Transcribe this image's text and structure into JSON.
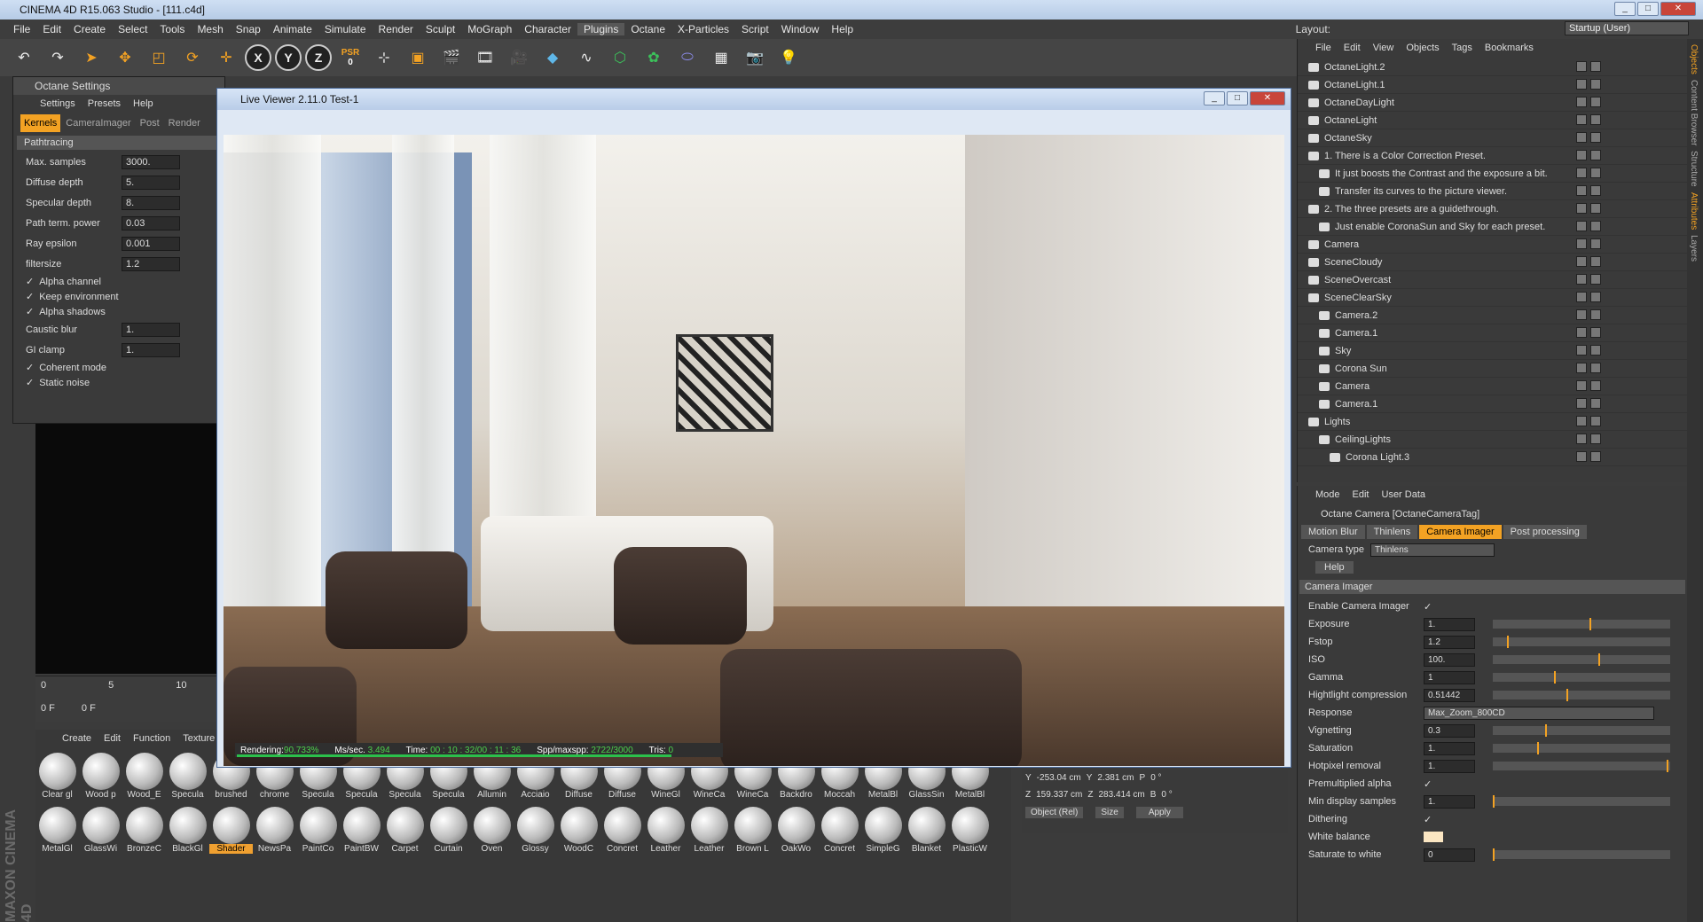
{
  "app": {
    "title": "CINEMA 4D R15.063 Studio - [111.c4d]",
    "layout_label": "Layout:",
    "layout_value": "Startup (User)"
  },
  "menu": [
    "File",
    "Edit",
    "Create",
    "Select",
    "Tools",
    "Mesh",
    "Snap",
    "Animate",
    "Simulate",
    "Render",
    "Sculpt",
    "MoGraph",
    "Character",
    "Plugins",
    "Octane",
    "X-Particles",
    "Script",
    "Window",
    "Help"
  ],
  "toolbar": {
    "x": "X",
    "y": "Y",
    "z": "Z",
    "psr": "PSR",
    "psr_num": "0"
  },
  "octane_settings": {
    "title": "Octane Settings",
    "menu": [
      "Settings",
      "Presets",
      "Help"
    ],
    "tabs": [
      "Kernels",
      "CameraImager",
      "Post",
      "Render"
    ],
    "section": "Pathtracing",
    "rows": [
      [
        "Max. samples",
        "3000."
      ],
      [
        "Diffuse depth",
        "5."
      ],
      [
        "Specular depth",
        "8."
      ],
      [
        "Path term. power",
        "0.03"
      ],
      [
        "Ray epsilon",
        "0.001"
      ],
      [
        "filtersize",
        "1.2"
      ]
    ],
    "checks": [
      "Alpha channel",
      "Keep environment",
      "Alpha shadows"
    ],
    "rows2": [
      [
        "Caustic blur",
        "1."
      ],
      [
        "GI clamp",
        "1."
      ]
    ],
    "checks2": [
      "Coherent mode",
      "Static noise"
    ]
  },
  "live_viewer": {
    "title": "Live Viewer 2.11.0 Test-1",
    "status": {
      "rendering_label": "Rendering:",
      "rendering": "90.733%",
      "ms_label": "Ms/sec.",
      "ms": "3.494",
      "time_label": "Time:",
      "time": "00 : 10 : 32/00 : 11 : 36",
      "spp_label": "Spp/maxspp:",
      "spp": "2722/3000",
      "tris_label": "Tris:",
      "tris": "0"
    },
    "progress": 0.907
  },
  "object_manager": {
    "menu": [
      "File",
      "Edit",
      "View",
      "Objects",
      "Tags",
      "Bookmarks"
    ],
    "items": [
      "OctaneLight.2",
      "OctaneLight.1",
      "OctaneDayLight",
      "OctaneLight",
      "OctaneSky",
      "1.  There is a Color Correction Preset.",
      "It just boosts the Contrast and the exposure a bit.",
      "Transfer its curves to the picture viewer.",
      "2.  The three presets are a guidethrough.",
      "Just enable CoronaSun and Sky for each preset.",
      "Camera",
      "SceneCloudy",
      "SceneOvercast",
      "SceneClearSky",
      "Camera.2",
      "Camera.1",
      "Sky",
      "Corona Sun",
      "Camera",
      "Camera.1",
      "Lights",
      "CeilingLights",
      "Corona Light.3"
    ]
  },
  "attr_manager": {
    "menu": [
      "Mode",
      "Edit",
      "User Data"
    ],
    "title": "Octane Camera [OctaneCameraTag]",
    "tabs": [
      "Motion Blur",
      "Thinlens",
      "Camera Imager",
      "Post processing"
    ],
    "camera_type_label": "Camera type",
    "camera_type": "Thinlens",
    "help": "Help",
    "section": "Camera Imager",
    "enable_label": "Enable Camera Imager",
    "rows": [
      [
        "Exposure",
        "1.",
        0.55
      ],
      [
        "Fstop",
        "1.2",
        0.08
      ],
      [
        "ISO",
        "100.",
        0.6
      ],
      [
        "Gamma",
        "1",
        0.35
      ],
      [
        "Hightlight compression",
        "0.51442",
        0.42
      ],
      [
        "Response",
        "Max_Zoom_800CD",
        -1
      ],
      [
        "Vignetting",
        "0.3",
        0.3
      ],
      [
        "Saturation",
        "1.",
        0.25
      ],
      [
        "Hotpixel removal",
        "1.",
        0.99
      ],
      [
        "Premultiplied alpha",
        "",
        -2
      ],
      [
        "Min display samples",
        "1.",
        0.0
      ],
      [
        "Dithering",
        "",
        -2
      ],
      [
        "White balance",
        "",
        -3
      ],
      [
        "Saturate to white",
        "0",
        0.0
      ]
    ]
  },
  "sidebar_tabs": [
    "Objects",
    "Content Browser",
    "Structure",
    "Attributes",
    "Layers"
  ],
  "timeline": {
    "ticks": [
      "0",
      "5",
      "10"
    ],
    "frame": "0 F",
    "frame2": "0 F"
  },
  "materials": {
    "menu": [
      "Create",
      "Edit",
      "Function",
      "Texture"
    ],
    "row1": [
      "Clear gl",
      "Wood p",
      "Wood_E",
      "Specula",
      "brushed",
      "chrome",
      "Specula",
      "Specula",
      "Specula",
      "Specula",
      "Allumin",
      "Acciaio",
      "Diffuse",
      "Diffuse",
      "WineGl",
      "WineCa",
      "WineCa",
      "Backdro",
      "Moccah",
      "MetalBl",
      "GlassSin",
      "MetalBl"
    ],
    "row2": [
      "MetalGl",
      "GlassWi",
      "BronzeC",
      "BlackGl",
      "Shader",
      "NewsPa",
      "PaintCo",
      "PaintBW",
      "Carpet",
      "Curtain",
      "Oven",
      "Glossy",
      "WoodC",
      "Concret",
      "Leather",
      "Leather",
      "Brown L",
      "OakWo",
      "Concret",
      "SimpleG",
      "Blanket",
      "PlasticW"
    ],
    "selected": "Shader"
  },
  "coords": {
    "y_label": "Y",
    "y": "-253.04 cm",
    "y2_label": "Y",
    "y2": "2.381 cm",
    "p_label": "P",
    "p": "0 °",
    "z_label": "Z",
    "z": "159.337 cm",
    "z2_label": "Z",
    "z2": "283.414 cm",
    "b_label": "B",
    "b": "0 °",
    "mode": "Object (Rel)",
    "size": "Size",
    "apply": "Apply"
  },
  "branding": "MAXON CINEMA 4D",
  "colors": {
    "accent": "#f3a223",
    "progress": "#2bc04b"
  }
}
